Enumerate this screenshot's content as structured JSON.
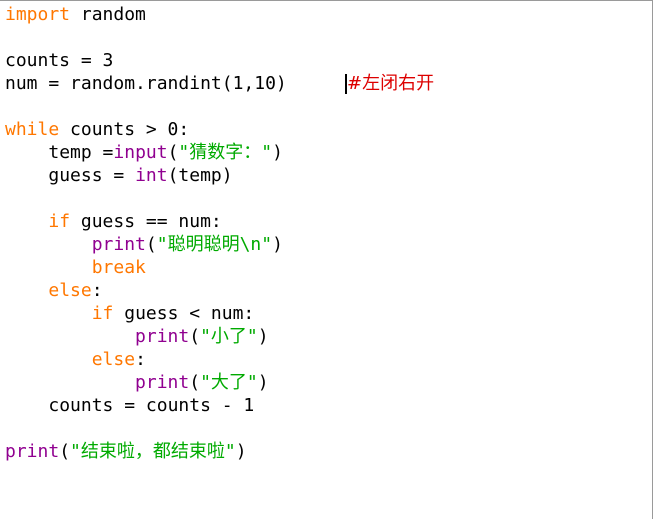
{
  "code": {
    "l1": {
      "kw": "import",
      "rest": " random"
    },
    "l3": {
      "text": "counts = 3"
    },
    "l4": {
      "text": "num = random.randint(1,10)",
      "comment": "#左闭右开"
    },
    "l6": {
      "kw": "while",
      "rest": " counts > 0:"
    },
    "l7": {
      "indent": "    ",
      "pre": "temp =",
      "bi": "input",
      "open": "(",
      "str": "\"猜数字：\"",
      "close": ")"
    },
    "l8": {
      "indent": "    ",
      "pre": "guess = ",
      "bi": "int",
      "rest": "(temp)"
    },
    "l10": {
      "indent": "    ",
      "kw": "if",
      "rest": " guess == num:"
    },
    "l11": {
      "indent": "        ",
      "bi": "print",
      "open": "(",
      "str": "\"聪明聪明\\n\"",
      "close": ")"
    },
    "l12": {
      "indent": "        ",
      "kw": "break"
    },
    "l13": {
      "indent": "    ",
      "kw": "else",
      "rest": ":"
    },
    "l14": {
      "indent": "        ",
      "kw": "if",
      "rest": " guess < num:"
    },
    "l15": {
      "indent": "            ",
      "bi": "print",
      "open": "(",
      "str": "\"小了\"",
      "close": ")"
    },
    "l16": {
      "indent": "        ",
      "kw": "else",
      "rest": ":"
    },
    "l17": {
      "indent": "            ",
      "bi": "print",
      "open": "(",
      "str": "\"大了\"",
      "close": ")"
    },
    "l18": {
      "indent": "    ",
      "text": "counts = counts - 1"
    },
    "l20": {
      "bi": "print",
      "open": "(",
      "str": "\"结束啦，都结束啦\"",
      "close": ")"
    }
  },
  "colors": {
    "keyword": "#ff7700",
    "builtin": "#900090",
    "string": "#00aa00",
    "comment": "#dd0000"
  }
}
